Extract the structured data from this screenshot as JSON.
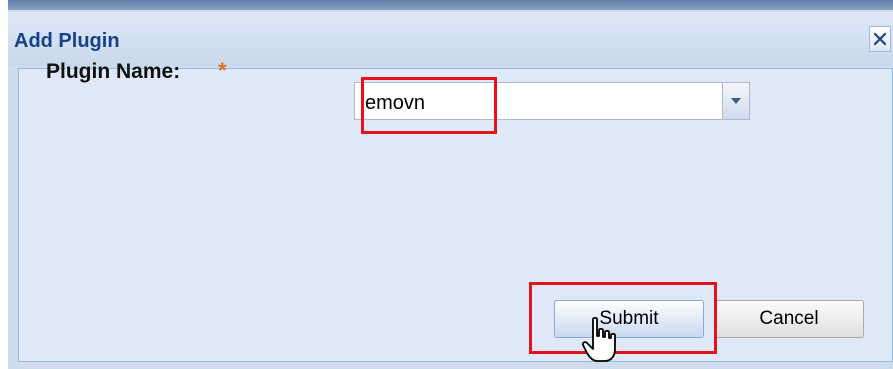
{
  "dialog": {
    "title": "Add Plugin",
    "close_icon": "close-icon"
  },
  "form": {
    "plugin_name_label": "Plugin Name:",
    "required_marker": "*",
    "plugin_name_value": "emovn",
    "dropdown_icon": "chevron-down-icon"
  },
  "buttons": {
    "submit_label": "Submit",
    "cancel_label": "Cancel"
  },
  "colors": {
    "title_text": "#15428b",
    "highlight": "#e3121d",
    "required": "#e07020",
    "body_bg": "#dfe8f6"
  },
  "cursor_icon": "hand-pointer-icon"
}
